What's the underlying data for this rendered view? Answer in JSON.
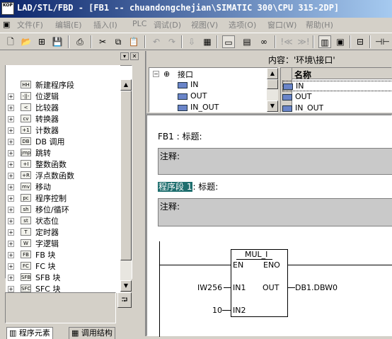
{
  "titlebar": {
    "icon_text": "KOP",
    "title": "LAD/STL/FBD  - [FB1 -- chuandongchejian\\SIMATIC 300\\CPU 315-2DP]"
  },
  "menu": [
    {
      "label": "文件(F)"
    },
    {
      "label": "编辑(E)"
    },
    {
      "label": "插入(I)"
    },
    {
      "label": "PLC"
    },
    {
      "label": "调试(D)"
    },
    {
      "label": "视图(V)"
    },
    {
      "label": "选项(O)"
    },
    {
      "label": "窗口(W)"
    },
    {
      "label": "帮助(H)"
    }
  ],
  "toolbar": {
    "contents_label": "内容：'环境\\接口'"
  },
  "tree": {
    "items": [
      {
        "label": "新建程序段",
        "icon": "HH"
      },
      {
        "label": "位逻辑",
        "icon": "-||-"
      },
      {
        "label": "比较器",
        "icon": "<"
      },
      {
        "label": "转换器",
        "icon": "cv"
      },
      {
        "label": "计数器",
        "icon": "+1"
      },
      {
        "label": "DB 调用",
        "icon": "DB"
      },
      {
        "label": "跳转",
        "icon": "jmp"
      },
      {
        "label": "整数函数",
        "icon": "+I"
      },
      {
        "label": "浮点数函数",
        "icon": "+R"
      },
      {
        "label": "移动",
        "icon": "mv"
      },
      {
        "label": "程序控制",
        "icon": "pc"
      },
      {
        "label": "移位/循环",
        "icon": "sh"
      },
      {
        "label": "状态位",
        "icon": "st"
      },
      {
        "label": "定时器",
        "icon": "T"
      },
      {
        "label": "字逻辑",
        "icon": "W"
      },
      {
        "label": "FB 块",
        "icon": "FB"
      },
      {
        "label": "FC 块",
        "icon": "FC"
      },
      {
        "label": "SFB 块",
        "icon": "SFB"
      },
      {
        "label": "SFC 块",
        "icon": "SFC"
      }
    ],
    "tab_program_elements": "程序元素",
    "tab_call_structure": "调用结构"
  },
  "interface": {
    "root": "接口",
    "items": [
      "IN",
      "OUT",
      "IN_OUT"
    ],
    "column_header": "名称",
    "right_items": [
      "IN",
      "OUT",
      "IN_OUT"
    ]
  },
  "editor": {
    "block_title": "FB1 : 标题:",
    "comment_label": "注释:",
    "network_label": "程序段 1",
    "network_suffix": ": 标题:",
    "network_comment_label": "注释:",
    "box": {
      "name": "MUL_I",
      "en": "EN",
      "eno": "ENO",
      "in1": "IN1",
      "in2": "IN2",
      "out": "OUT",
      "in1_operand": "IW256",
      "in2_operand": "10",
      "out_operand": "DB1.DBW0"
    }
  }
}
